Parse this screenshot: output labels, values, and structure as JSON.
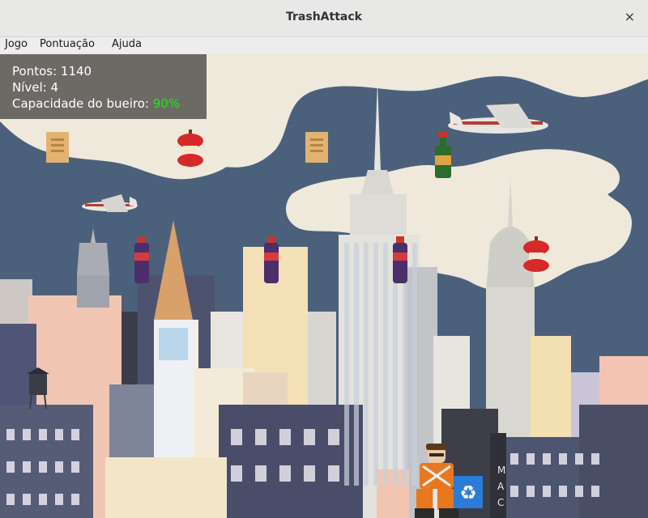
{
  "window": {
    "title": "TrashAttack",
    "close_glyph": "×"
  },
  "menu": {
    "items": [
      "Jogo",
      "Pontuação",
      "Ajuda"
    ]
  },
  "hud": {
    "score_label": "Pontos:",
    "score_value": "1140",
    "level_label": "Nível:",
    "level_value": "4",
    "capacity_label": "Capacidade do bueiro:",
    "capacity_value": "90%"
  },
  "sprites": {
    "water_tower_icon": "water-tower",
    "recycle_icon": "recycle",
    "sign_text": "MAC",
    "trash": [
      "newspaper",
      "apple-core",
      "newspaper",
      "green-bottle",
      "soda-bottle",
      "soda-bottle",
      "soda-bottle",
      "apple-core"
    ]
  },
  "colors": {
    "sky": "#4a5f7a",
    "cloud": "#efe9dc",
    "hud_green": "#22e51c",
    "player_shirt": "#e8781e"
  }
}
